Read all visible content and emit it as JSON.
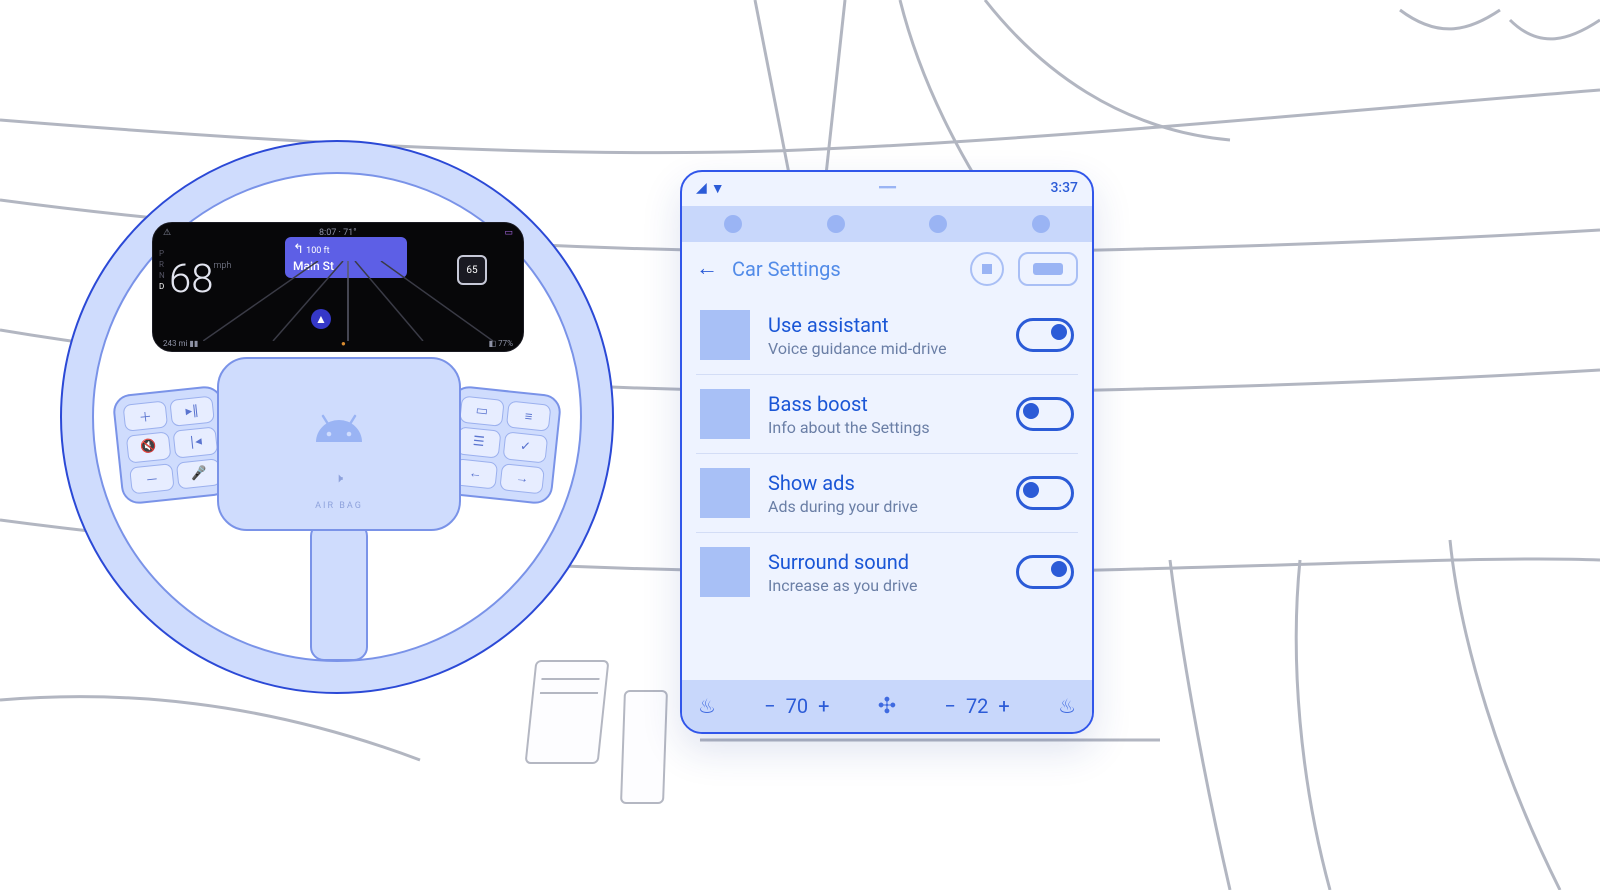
{
  "cluster": {
    "speed": "68",
    "speed_unit": "mph",
    "gears": [
      "P",
      "R",
      "N",
      "D"
    ],
    "gear_active": "D",
    "nav_distance": "100 ft",
    "nav_street": "Main St",
    "speed_limit": "65",
    "time_temp": "8:07 · 71°",
    "range": "243 mi",
    "battery": "77%"
  },
  "tablet": {
    "time": "3:37",
    "title": "Car Settings",
    "settings": [
      {
        "title": "Use assistant",
        "subtitle": "Voice guidance mid-drive",
        "on": true
      },
      {
        "title": "Bass boost",
        "subtitle": "Info about the Settings",
        "on": false
      },
      {
        "title": "Show ads",
        "subtitle": "Ads during your drive",
        "on": false
      },
      {
        "title": "Surround sound",
        "subtitle": "Increase as you drive",
        "on": true
      }
    ],
    "climate": {
      "left_temp": "70",
      "right_temp": "72"
    }
  },
  "hub": {
    "airbag_label": "AIR BAG"
  }
}
